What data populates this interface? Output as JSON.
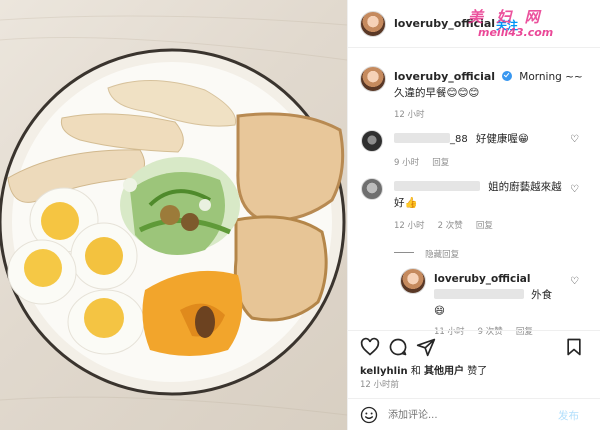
{
  "header": {
    "username": "loveruby_official",
    "follow_label": "关注"
  },
  "caption": {
    "username": "loveruby_official",
    "verified": true,
    "text": "Morning ~~",
    "line2": "久違的早餐😊😊😊",
    "time": "12 小时"
  },
  "comments": [
    {
      "username_suffix": "_88",
      "text": "好健康喔😁",
      "time": "9 小时",
      "reply_label": "回复"
    },
    {
      "text": "姐的廚藝越來越好👍",
      "time": "12 小时",
      "likes": "2 次赞",
      "reply_label": "回复",
      "hide_replies_label": "隐藏回复"
    },
    {
      "username": "loveruby_official",
      "text": "外食",
      "emoji": "😄",
      "time": "11 小时",
      "likes": "9 次赞",
      "reply_label": "回复"
    }
  ],
  "likes_line": {
    "user": "kellyhlin",
    "joiner": "和",
    "others": "其他用户",
    "suffix": "赞了"
  },
  "post_time": "12 小时前",
  "add_comment": {
    "placeholder": "添加评论...",
    "post_label": "发布"
  },
  "watermark": {
    "top": "美 妇 网",
    "bottom": "meili43.com",
    "color_top": "#e8348c",
    "color_bottom": "#e8348c"
  },
  "colors": {
    "link_blue": "#0095f6",
    "verified_blue": "#3897f0",
    "text": "#262626",
    "muted": "#8e8e8e"
  }
}
